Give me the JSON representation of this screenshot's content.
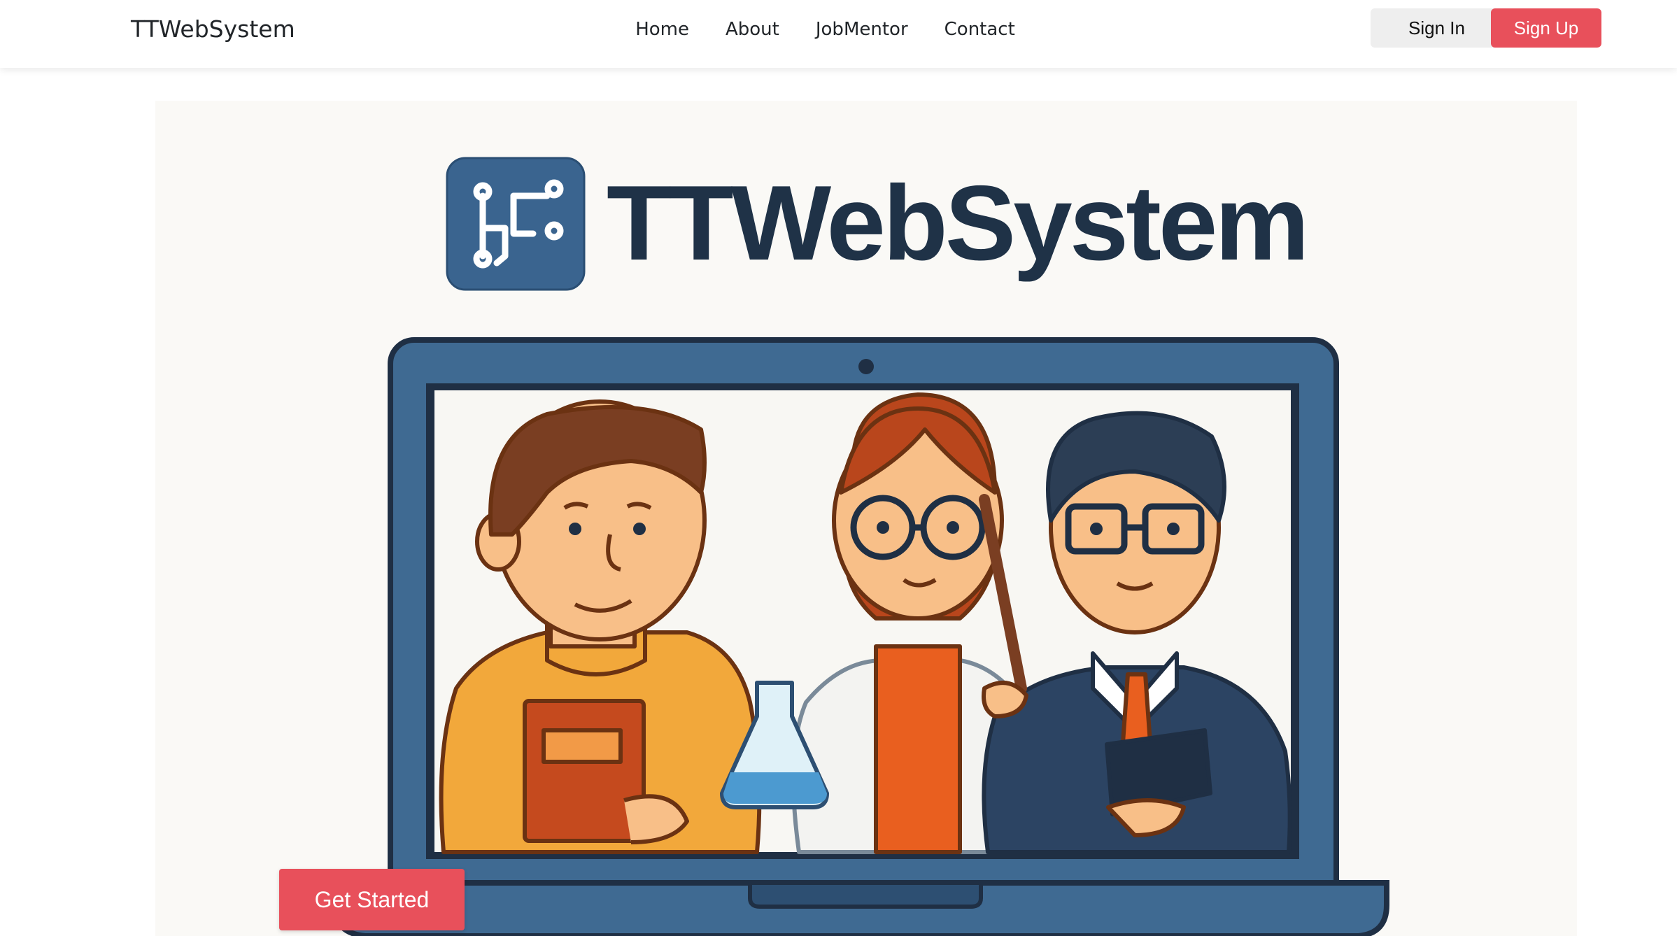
{
  "navbar": {
    "brand": "TTWebSystem",
    "links": [
      "Home",
      "About",
      "JobMentor",
      "Contact"
    ],
    "sign_in": "Sign In",
    "sign_up": "Sign Up"
  },
  "hero": {
    "logo_text": "TTWebSystem",
    "cta": "Get Started"
  },
  "colors": {
    "accent": "#e8505b",
    "logo_blue": "#3a648f",
    "logo_text": "#1f3247",
    "laptop": "#3f6a92"
  },
  "icons": [
    "circuit-logo-icon",
    "laptop-illustration",
    "webcam-icon"
  ]
}
